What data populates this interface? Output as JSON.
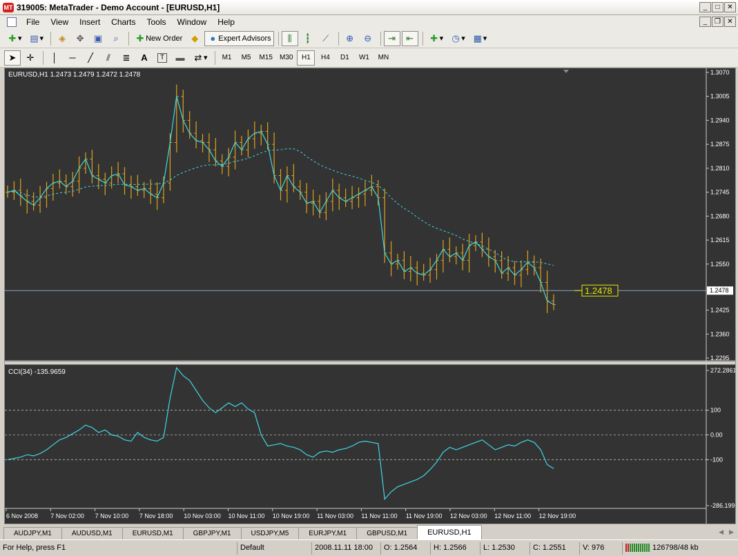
{
  "window": {
    "title": "319005: MetaTrader - Demo Account - [EURUSD,H1]",
    "app_icon": "metatrader-logo-icon",
    "minimize": "_",
    "maximize": "□",
    "close": "✕",
    "restore": "❐"
  },
  "menu": [
    "File",
    "View",
    "Insert",
    "Charts",
    "Tools",
    "Window",
    "Help"
  ],
  "toolbar": {
    "new_order": "New Order",
    "expert_advisors": "Expert Advisors"
  },
  "timeframes": [
    "M1",
    "M5",
    "M15",
    "M30",
    "H1",
    "H4",
    "D1",
    "W1",
    "MN"
  ],
  "active_timeframe": "H1",
  "chart": {
    "info": "EURUSD,H1  1.2473 1.2479 1.2472 1.2478",
    "current_price": "1.2478",
    "price_label": "1.2478",
    "price_ticks": [
      "1.3070",
      "1.3005",
      "1.2940",
      "1.2875",
      "1.2810",
      "1.2745",
      "1.2680",
      "1.2615",
      "1.2550",
      "1.2425",
      "1.2360",
      "1.2295"
    ],
    "price_range": [
      1.2295,
      1.307
    ],
    "cci_label": "CCI(34) -135.9659",
    "cci_ticks": [
      "272.2861",
      "100",
      "0.00",
      "-100",
      "-286.199"
    ],
    "cci_range": [
      -286.199,
      272.2861
    ],
    "time_ticks": [
      "6 Nov 2008",
      "7 Nov 02:00",
      "7 Nov 10:00",
      "7 Nov 18:00",
      "10 Nov 03:00",
      "10 Nov 11:00",
      "10 Nov 19:00",
      "11 Nov 03:00",
      "11 Nov 11:00",
      "11 Nov 19:00",
      "12 Nov 03:00",
      "12 Nov 11:00",
      "12 Nov 19:00"
    ],
    "colors": {
      "background": "#333333",
      "bars": "#e0a21a",
      "fast_line": "#3fd8e6",
      "ma_line": "#3fd8e6",
      "price_line": "#8fa8b8",
      "label_border": "#e6e600"
    }
  },
  "chart_data": {
    "type": "line",
    "title": "EURUSD,H1",
    "x_range": [
      "6 Nov 2008",
      "12 Nov 19:00"
    ],
    "series": [
      {
        "name": "EURUSD,H1",
        "values": [
          1.2745,
          1.275,
          1.2735,
          1.272,
          1.271,
          1.273,
          1.2755,
          1.277,
          1.2775,
          1.276,
          1.2775,
          1.281,
          1.2835,
          1.279,
          1.278,
          1.277,
          1.279,
          1.2795,
          1.2765,
          1.276,
          1.275,
          1.2755,
          1.274,
          1.273,
          1.277,
          1.288,
          1.3005,
          1.294,
          1.2905,
          1.2885,
          1.288,
          1.286,
          1.283,
          1.2815,
          1.284,
          1.288,
          1.286,
          1.289,
          1.2905,
          1.291,
          1.2875,
          1.279,
          1.275,
          1.279,
          1.276,
          1.2745,
          1.2715,
          1.272,
          1.269,
          1.272,
          1.275,
          1.273,
          1.272,
          1.273,
          1.274,
          1.275,
          1.276,
          1.273,
          1.258,
          1.255,
          1.256,
          1.253,
          1.254,
          1.2525,
          1.252,
          1.2535,
          1.256,
          1.259,
          1.257,
          1.258,
          1.256,
          1.26,
          1.261,
          1.259,
          1.257,
          1.256,
          1.2525,
          1.254,
          1.252,
          1.2535,
          1.2555,
          1.254,
          1.25,
          1.245,
          1.244
        ]
      },
      {
        "name": "CCI(34)",
        "values": [
          -100,
          -95,
          -90,
          -80,
          -85,
          -75,
          -60,
          -40,
          -20,
          -10,
          5,
          20,
          40,
          30,
          10,
          20,
          0,
          -5,
          -20,
          -25,
          10,
          -10,
          -20,
          -25,
          -10,
          150,
          272,
          240,
          220,
          180,
          140,
          110,
          90,
          110,
          130,
          115,
          130,
          105,
          90,
          0,
          -45,
          -40,
          -35,
          -45,
          -50,
          -60,
          -80,
          -90,
          -70,
          -65,
          -70,
          -60,
          -55,
          -45,
          -30,
          -25,
          -30,
          -35,
          -260,
          -230,
          -210,
          -200,
          -190,
          -180,
          -165,
          -140,
          -110,
          -70,
          -50,
          -60,
          -50,
          -40,
          -30,
          -20,
          -40,
          -60,
          -50,
          -40,
          -45,
          -30,
          -20,
          -30,
          -60,
          -120,
          -136
        ]
      }
    ],
    "ylim": [
      1.2295,
      1.307
    ],
    "xlabel": "",
    "ylabel": "",
    "grid": false
  },
  "tabs": [
    "AUDJPY,M1",
    "AUDUSD,M1",
    "EURUSD,M1",
    "GBPJPY,M1",
    "USDJPY,M5",
    "EURJPY,M1",
    "GBPUSD,M1",
    "EURUSD,H1"
  ],
  "active_tab": "EURUSD,H1",
  "status": {
    "help": "For Help, press F1",
    "profile": "Default",
    "datetime": "2008.11.11 18:00",
    "open": "O: 1.2564",
    "high": "H: 1.2566",
    "low": "L: 1.2530",
    "close": "C: 1.2551",
    "volume": "V: 976",
    "traffic": "126798/48 kb"
  }
}
